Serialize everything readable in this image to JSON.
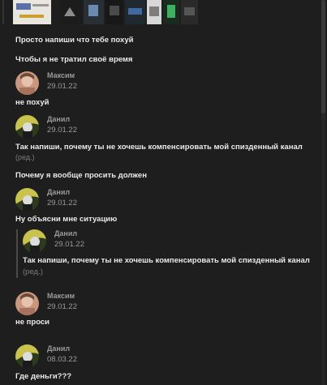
{
  "messages": {
    "m1": "Просто напиши что тебе похуй",
    "m2": "Чтобы я не тратил своё время",
    "h1": {
      "author": "Максим",
      "date": "29.01.22"
    },
    "m3": "не похуй",
    "h2": {
      "author": "Данил",
      "date": "29.01.22"
    },
    "m4": "Так напиши, почему ты не хочешь компенсировать мой спизденный канал",
    "m4_edited": "(ред.)",
    "m5": "Почему я вообще просить должен",
    "h3": {
      "author": "Данил",
      "date": "29.01.22"
    },
    "m6": "Ну объясни мне ситуацию",
    "quote": {
      "author": "Данил",
      "date": "29.01.22",
      "text": "Так напиши, почему ты не хочешь компенсировать мой спизденный канал",
      "edited": "(ред.)"
    },
    "h4": {
      "author": "Максим",
      "date": "29.01.22"
    },
    "m7": "не проси",
    "h5": {
      "author": "Данил",
      "date": "08.03.22"
    },
    "m8": "Где деньги???"
  }
}
